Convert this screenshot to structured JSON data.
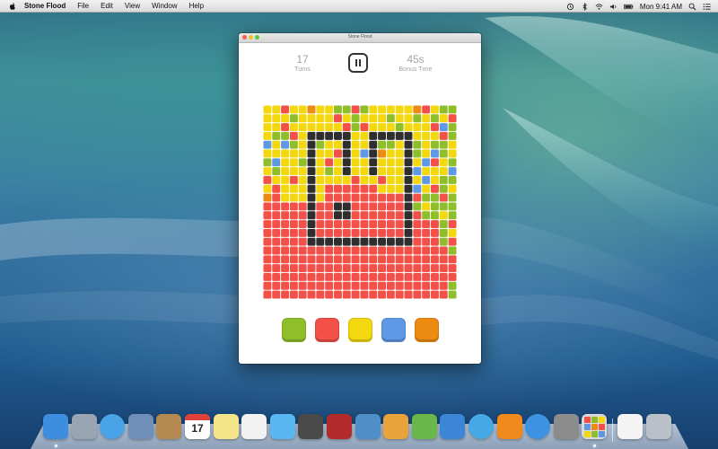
{
  "menubar": {
    "app_name": "Stone Flood",
    "menus": [
      "File",
      "Edit",
      "View",
      "Window",
      "Help"
    ],
    "clock": "Mon 9:41 AM"
  },
  "window": {
    "title": "Stone Flood",
    "turns_value": "17",
    "turns_label": "Turns",
    "bonus_value": "45s",
    "bonus_label": "Bonus Time"
  },
  "colors": {
    "G": "#8ebf2a",
    "R": "#f25048",
    "Y": "#f3d80f",
    "B": "#5f98e4",
    "O": "#ec8a12",
    "K": "#2e2e2e"
  },
  "board_rows": [
    "YYRYYOYYGGRGYYYYYORYGG",
    "YYYGYYYYRYGYYYGYYGYGYR",
    "YYRYYYYYYRGRYYYGYYYRBG",
    "YGGRYKKKKKYYKKKKKYYYRG",
    "BYBGYKGYYKYYKGGYKGYGGY",
    "YYYYYKYYRKYBKOYYKGYBGY",
    "GBYYGKYRYKYYKYYYKYBRYG",
    "YGYYYKYGYKYYKYYYKBYYYB",
    "RYYRYKYYYYRYYRYYKYBYGG",
    "YRYYYKYRRRRRRYYYKBYRGY",
    "ORYYYKYRRRRRRRRRKRGGRG",
    "RRRRRKRRKKRRRRRRKGYGGG",
    "RRRRRKRRKKRRRRRRKRGGYG",
    "RRRRRKRRRRRRRRRRKRRRGR",
    "RRRRRKRRRRRRRRRRKRRRGY",
    "RRRRRKKKKKKKKKKKKRRRGR",
    "RRRRRRRRRRRRRRRRRRRRRG",
    "RRRRRRRRRRRRRRRRRRRRRR",
    "RRRRRRRRRRRRRRRRRRRRRR",
    "RRRRRRRRRRRRRRRRRRRRRRG",
    "RRRRRRRRRRRRRRRRRRRRRG",
    "RRRRRRRRRRRRRRRRRRRRRG"
  ],
  "color_buttons": [
    {
      "name": "green",
      "color": "#8ebf2a"
    },
    {
      "name": "red",
      "color": "#f25048"
    },
    {
      "name": "yellow",
      "color": "#f3d80f"
    },
    {
      "name": "blue",
      "color": "#5f98e4"
    },
    {
      "name": "orange",
      "color": "#ec8a12"
    }
  ],
  "dock_items": [
    {
      "name": "finder",
      "icon": "finder-icon",
      "color": "#3e8ee0"
    },
    {
      "name": "launchpad",
      "icon": "launchpad-icon",
      "color": "#9aa5b4"
    },
    {
      "name": "safari",
      "icon": "safari-icon",
      "color": "#4aa3e6"
    },
    {
      "name": "mail",
      "icon": "mail-icon",
      "color": "#6f8fb8"
    },
    {
      "name": "contacts",
      "icon": "contacts-icon",
      "color": "#b48a52"
    },
    {
      "name": "calendar",
      "icon": "calendar-icon",
      "color": "#ffffff",
      "text": "17"
    },
    {
      "name": "notes",
      "icon": "notes-icon",
      "color": "#f4e48a"
    },
    {
      "name": "reminders",
      "icon": "reminders-icon",
      "color": "#f2f2f2"
    },
    {
      "name": "messages",
      "icon": "messages-icon",
      "color": "#59b6f0"
    },
    {
      "name": "facetime",
      "icon": "facetime-icon",
      "color": "#4a4a4a"
    },
    {
      "name": "photo-booth",
      "icon": "photo-booth-icon",
      "color": "#b32a2a"
    },
    {
      "name": "iphoto",
      "icon": "iphoto-icon",
      "color": "#4f8ec7"
    },
    {
      "name": "pages",
      "icon": "pages-icon",
      "color": "#e8a33a"
    },
    {
      "name": "numbers",
      "icon": "numbers-icon",
      "color": "#6bb84a"
    },
    {
      "name": "keynote",
      "icon": "keynote-icon",
      "color": "#3b86d6"
    },
    {
      "name": "itunes",
      "icon": "itunes-icon",
      "color": "#47a8e6"
    },
    {
      "name": "ibooks",
      "icon": "ibooks-icon",
      "color": "#f08a1c"
    },
    {
      "name": "app-store",
      "icon": "app-store-icon",
      "color": "#3d92e2"
    },
    {
      "name": "system-preferences",
      "icon": "gear-icon",
      "color": "#8c8c8c"
    },
    {
      "name": "stone-flood",
      "icon": "stone-flood-icon",
      "color": "#d9d9d9"
    },
    {
      "name": "documents",
      "icon": "documents-icon",
      "color": "#f4f4f4"
    },
    {
      "name": "trash",
      "icon": "trash-icon",
      "color": "#b9c0c8"
    }
  ]
}
